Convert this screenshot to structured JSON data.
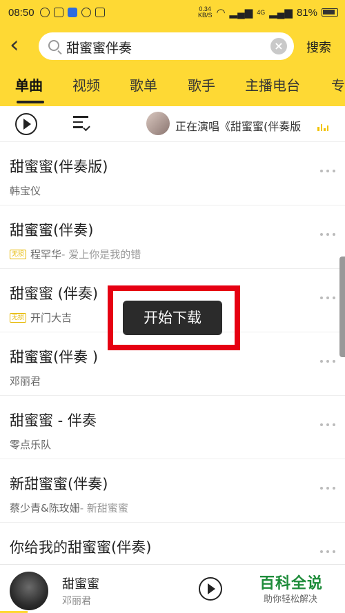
{
  "status_bar": {
    "time": "08:50",
    "net_speed_value": "0.34",
    "net_speed_unit": "KB/S",
    "signal_label": "4G",
    "battery": "81%"
  },
  "header": {
    "search_query": "甜蜜蜜伴奏",
    "search_button": "搜索"
  },
  "tabs": [
    "单曲",
    "视频",
    "歌单",
    "歌手",
    "主播电台",
    "专"
  ],
  "now_playing": {
    "text": "正在演唱《甜蜜蜜(伴奏版"
  },
  "songs": [
    {
      "title": "甜蜜蜜(伴奏版)",
      "badge": "",
      "artist": "韩宝仪",
      "album": ""
    },
    {
      "title": "甜蜜蜜(伴奏)",
      "badge": "无损",
      "artist": "程罕华",
      "album": " - 爱上你是我的错"
    },
    {
      "title": "甜蜜蜜 (伴奏)",
      "badge": "无损",
      "artist": "开门大吉",
      "album": ""
    },
    {
      "title": "甜蜜蜜(伴奏 )",
      "badge": "",
      "artist": "邓丽君",
      "album": ""
    },
    {
      "title": "甜蜜蜜 - 伴奏",
      "badge": "",
      "artist": "零点乐队",
      "album": ""
    },
    {
      "title": "新甜蜜蜜(伴奏)",
      "badge": "",
      "artist": "蔡少青&陈玫姗",
      "album": " - 新甜蜜蜜"
    },
    {
      "title": "你给我的甜蜜蜜(伴奏)",
      "badge": "",
      "artist": "",
      "album": ""
    }
  ],
  "toast": "开始下载",
  "mini_player": {
    "song": "甜蜜蜜",
    "artist": "邓丽君",
    "progress": 0.08
  },
  "watermark": {
    "title": "百科全说",
    "subtitle": "助你轻松解决"
  }
}
